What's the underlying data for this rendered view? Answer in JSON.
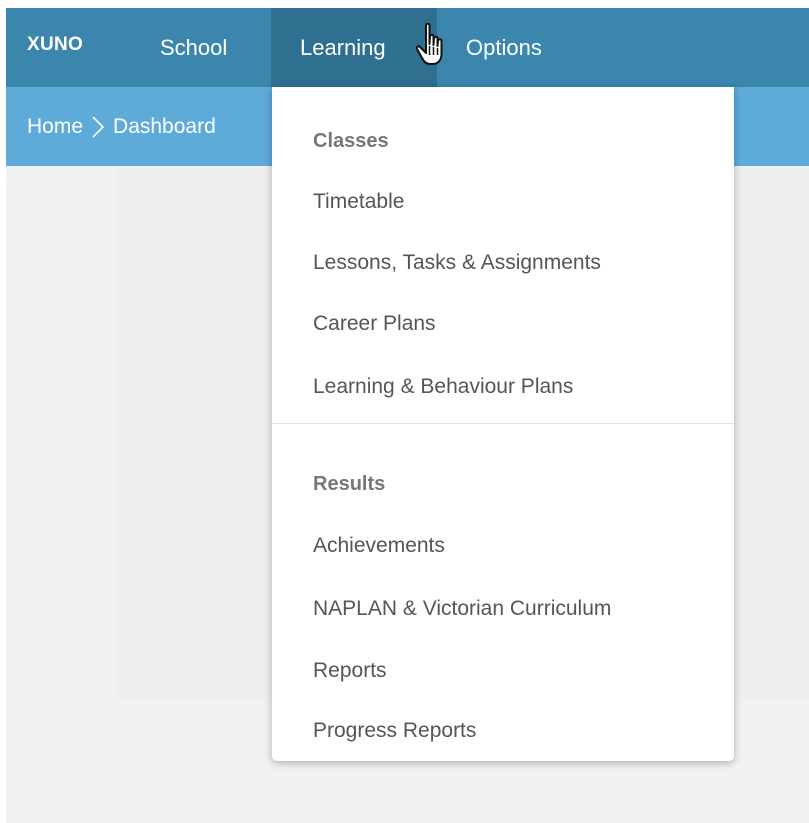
{
  "topbar": {
    "brand": "XUNO",
    "nav": {
      "school": "School",
      "learning": "Learning",
      "options": "Options"
    }
  },
  "breadcrumb": {
    "home": "Home",
    "dashboard": "Dashboard"
  },
  "dropdown": {
    "section_classes": "Classes",
    "classes_items": [
      "Timetable",
      "Lessons, Tasks & Assignments",
      "Career Plans",
      "Learning & Behaviour Plans"
    ],
    "section_results": "Results",
    "results_items": [
      "Achievements",
      "NAPLAN & Victorian Curriculum",
      "Reports",
      "Progress Reports"
    ]
  }
}
